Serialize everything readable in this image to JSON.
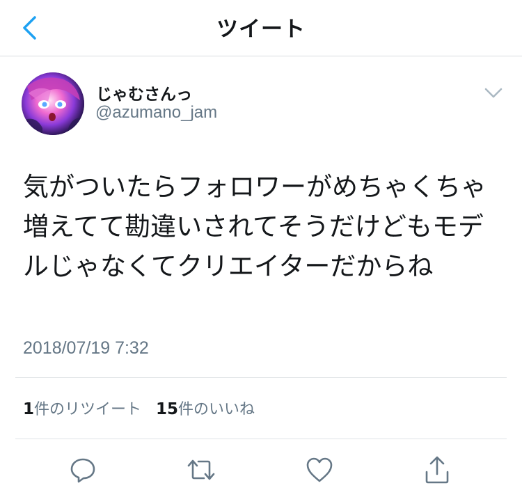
{
  "header": {
    "title": "ツイート",
    "back_icon": "chevron-left-icon",
    "accent_color": "#1da1f2"
  },
  "tweet": {
    "author": {
      "display_name": "じゃむさんっ",
      "handle": "@azumano_jam",
      "avatar": "avatar-image"
    },
    "menu_icon": "chevron-down-icon",
    "text": "気がついたらフォロワーがめちゃくちゃ増えてて勘違いされてそうだけどもモデルじゃなくてクリエイターだからね",
    "timestamp": "2018/07/19 7:32",
    "stats": {
      "retweets_count": "1",
      "retweets_label": "件のリツイート",
      "likes_count": "15",
      "likes_label": "件のいいね"
    },
    "actions": [
      {
        "name": "reply",
        "icon": "reply-icon"
      },
      {
        "name": "retweet",
        "icon": "retweet-icon"
      },
      {
        "name": "like",
        "icon": "heart-icon"
      },
      {
        "name": "share",
        "icon": "share-icon"
      }
    ]
  },
  "colors": {
    "text_primary": "#14171a",
    "text_secondary": "#657786",
    "divider": "#dfe3e6"
  }
}
